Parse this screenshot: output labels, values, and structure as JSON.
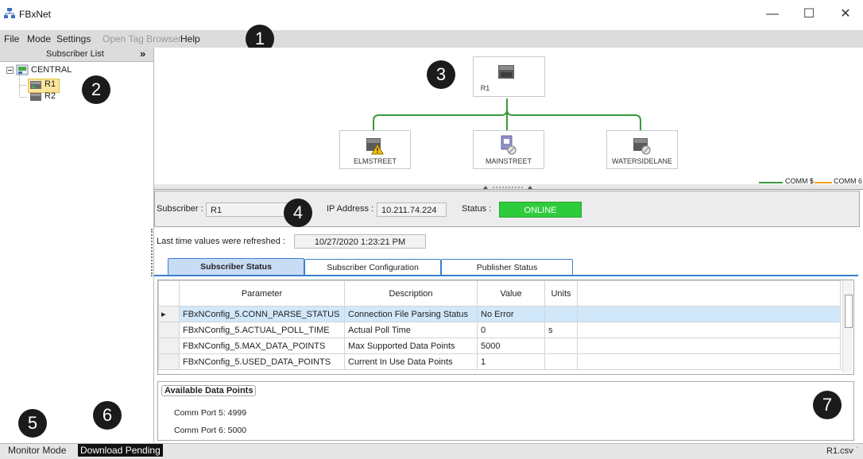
{
  "window": {
    "title": "FBxNet",
    "minimize": "—",
    "maximize": "☐",
    "close": "✕"
  },
  "menu": [
    "File",
    "Mode",
    "Settings",
    "Open Tag Browser",
    "Help"
  ],
  "markers": [
    "1",
    "2",
    "3",
    "4",
    "5",
    "6",
    "7"
  ],
  "subscriber_list": {
    "header": "Subscriber List",
    "collapse": "»",
    "root": "CENTRAL",
    "items": [
      "R1",
      "R2"
    ]
  },
  "diagram": {
    "root": "R1",
    "children": [
      "ELMSTREET",
      "MAINSTREET",
      "WATERSIDELANE"
    ],
    "legend": [
      "COMM 5",
      "|",
      "COMM 6"
    ],
    "colors": {
      "comm5": "#3a9a3a",
      "comm6": "#f0a020",
      "link": "#3a9a3a"
    }
  },
  "info": {
    "subscriber_label": "Subscriber :",
    "subscriber_value": "R1",
    "ip_label": "IP Address :",
    "ip_value": "10.211.74.224",
    "status_label": "Status :",
    "status_value": "ONLINE",
    "refresh_label": "Last time values were refreshed :",
    "refresh_value": "10/27/2020 1:23:21 PM"
  },
  "tabs": [
    "Subscriber Status",
    "Subscriber Configuration",
    "Publisher Status"
  ],
  "grid": {
    "columns": [
      "Parameter",
      "Description",
      "Value",
      "Units"
    ],
    "rows": [
      [
        "FBxNConfig_5.CONN_PARSE_STATUS",
        "Connection File Parsing Status",
        "No Error",
        ""
      ],
      [
        "FBxNConfig_5.ACTUAL_POLL_TIME",
        "Actual Poll Time",
        "0",
        "s"
      ],
      [
        "FBxNConfig_5.MAX_DATA_POINTS",
        "Max Supported Data Points",
        "5000",
        ""
      ],
      [
        "FBxNConfig_5.USED_DATA_POINTS",
        "Current In Use Data Points",
        "1",
        ""
      ]
    ]
  },
  "available": {
    "title": "Available Data Points",
    "port5": "Comm Port 5:  4999",
    "port6": "Comm Port 6:  5000"
  },
  "statusbar": {
    "mode": "Monitor Mode",
    "pending": "Download Pending",
    "file": "R1.csv"
  }
}
